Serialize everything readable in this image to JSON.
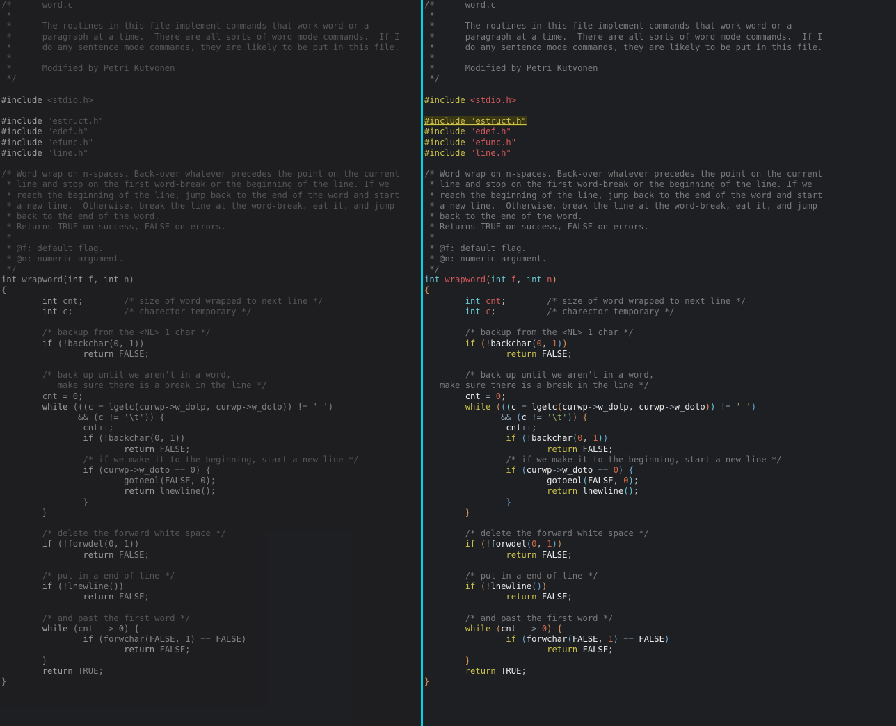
{
  "comment_header": [
    "/*      word.c",
    " *",
    " *      The routines in this file implement commands that work word or a",
    " *      paragraph at a time.  There are all sorts of word mode commands.  If I",
    " *      do any sentence mode commands, they are likely to be put in this file.",
    " *",
    " *      Modified by Petri Kutvonen",
    " */"
  ],
  "includes": {
    "stdio": "<stdio.h>",
    "estruct": "\"estruct.h\"",
    "edef": "\"edef.h\"",
    "efunc": "\"efunc.h\"",
    "line": "\"line.h\""
  },
  "doc_block": [
    "/* Word wrap on n-spaces. Back-over whatever precedes the point on the current",
    " * line and stop on the first word-break or the beginning of the line. If we",
    " * reach the beginning of the line, jump back to the end of the word and start",
    " * a new line.  Otherwise, break the line at the word-break, eat it, and jump",
    " * back to the end of the word.",
    " * Returns TRUE on success, FALSE on errors.",
    " *",
    " * @f: default flag.",
    " * @n: numeric argument.",
    " */"
  ],
  "fn": {
    "ret": "int",
    "name": "wrapword",
    "params": {
      "t1": "int",
      "p1": "f",
      "t2": "int",
      "p2": "n"
    }
  },
  "body": {
    "decl_cnt": {
      "type": "int",
      "name": "cnt",
      "comment": "/* size of word wrapped to next line */"
    },
    "decl_c": {
      "type": "int",
      "name": "c",
      "comment": "/* charector temporary */"
    },
    "c_backup1": "/* backup from the <NL> 1 char */",
    "if_back": {
      "fn": "backchar",
      "a0": "0",
      "a1": "1",
      "ret": "FALSE"
    },
    "c_backup2a": "/* back up until we aren't in a word,",
    "c_backup2b": "   make sure there is a break in the line */",
    "cnt0": {
      "lhs": "cnt",
      "rhs": "0"
    },
    "while1": {
      "kw": "while",
      "c": "c",
      "fn": "lgetc",
      "arg1": "curwp",
      "m1": "w_dotp",
      "arg2": "curwp",
      "m2": "w_doto",
      "cmp1": "' '",
      "cmp2": "'\\t'",
      "inc": "cnt",
      "if_back": {
        "fn": "backchar",
        "a0": "0",
        "a1": "1",
        "ret": "FALSE"
      },
      "c_begin": "/* if we make it to the beginning, start a new line */",
      "if_doto": {
        "obj": "curwp",
        "mem": "w_doto",
        "eq": "0",
        "call1": "gotoeol",
        "c1a": "FALSE",
        "c1b": "0",
        "call2": "lnewline"
      }
    },
    "c_delws": "/* delete the forward white space */",
    "if_forwdel": {
      "fn": "forwdel",
      "a0": "0",
      "a1": "1",
      "ret": "FALSE"
    },
    "c_eol": "/* put in a end of line */",
    "if_lnew": {
      "fn": "lnewline",
      "ret": "FALSE"
    },
    "c_past": "/* and past the first word */",
    "while2": {
      "kw": "while",
      "lhs": "cnt",
      "rhs": "0",
      "if_fwd": {
        "fn": "forwchar",
        "a0": "FALSE",
        "a1": "1",
        "eq": "FALSE",
        "ret": "FALSE"
      }
    },
    "ret_true": "TRUE"
  },
  "editor_state": {
    "focused_pane": "right",
    "highlighted_line_index": 11,
    "highlighted_text": "#include \"estruct.h\""
  }
}
